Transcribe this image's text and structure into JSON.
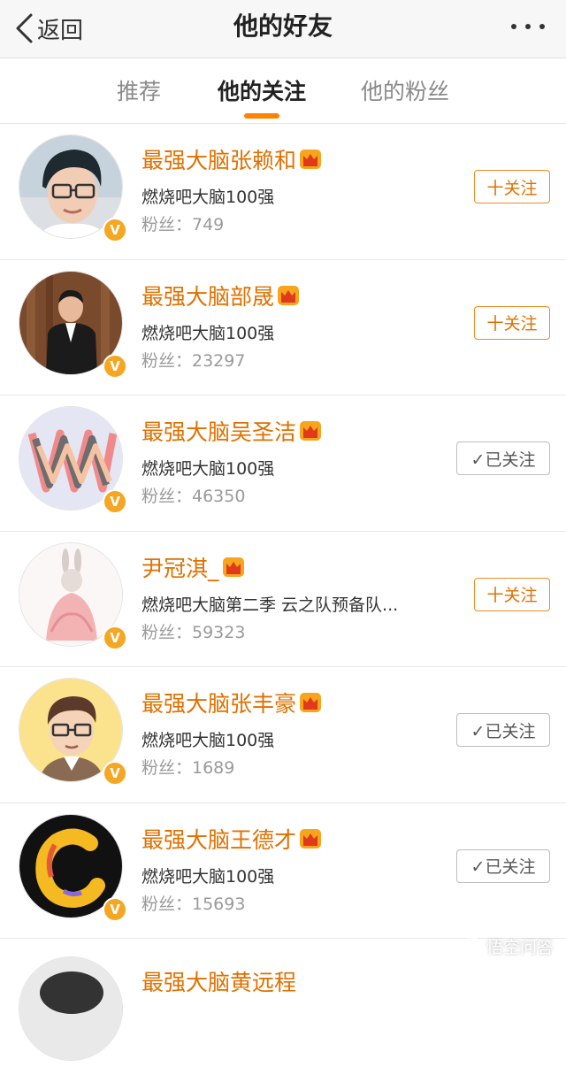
{
  "header": {
    "back_label": "返回",
    "title": "他的好友"
  },
  "tabs": [
    {
      "label": "推荐"
    },
    {
      "label": "他的关注"
    },
    {
      "label": "他的粉丝"
    }
  ],
  "colors": {
    "accent": "#ff8200",
    "name": "#e07100",
    "verified_badge": "#f5a623"
  },
  "users": [
    {
      "name": "最强大脑张赖和",
      "desc": "燃烧吧大脑100强",
      "fans": "粉丝：749",
      "button": "十关注",
      "followed": false
    },
    {
      "name": "最强大脑部晟",
      "desc": "燃烧吧大脑100强",
      "fans": "粉丝：23297",
      "button": "十关注",
      "followed": false
    },
    {
      "name": "最强大脑吴圣洁",
      "desc": "燃烧吧大脑100强",
      "fans": "粉丝：46350",
      "button": "✓已关注",
      "followed": true
    },
    {
      "name": "尹冠淇_",
      "desc": "燃烧吧大脑第二季 云之队预备队...",
      "fans": "粉丝：59323",
      "button": "十关注",
      "followed": false
    },
    {
      "name": "最强大脑张丰豪",
      "desc": "燃烧吧大脑100强",
      "fans": "粉丝：1689",
      "button": "✓已关注",
      "followed": true
    },
    {
      "name": "最强大脑王德才",
      "desc": "燃烧吧大脑100强",
      "fans": "粉丝：15693",
      "button": "✓已关注",
      "followed": true
    },
    {
      "name": "最强大脑黄远程"
    }
  ],
  "verified_badge_text": "V",
  "watermark": "悟空问答"
}
